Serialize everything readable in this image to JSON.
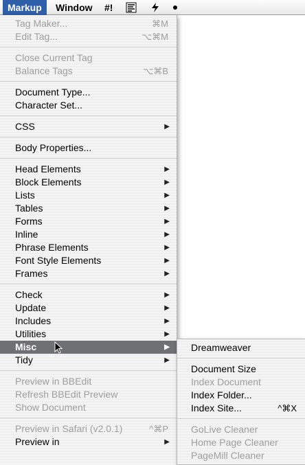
{
  "menubar": {
    "markup": "Markup",
    "window": "Window",
    "hashbang": "#!",
    "icon1": "script-icon",
    "icon2": "lightning-icon"
  },
  "menu": {
    "tag_maker": "Tag Maker...",
    "tag_maker_sc": "⌘M",
    "edit_tag": "Edit Tag...",
    "edit_tag_sc": "⌥⌘M",
    "close_tag": "Close Current Tag",
    "balance_tags": "Balance Tags",
    "balance_tags_sc": "⌥⌘B",
    "doc_type": "Document Type...",
    "char_set": "Character Set...",
    "css": "CSS",
    "body_props": "Body Properties...",
    "head_elements": "Head Elements",
    "block_elements": "Block Elements",
    "lists": "Lists",
    "tables": "Tables",
    "forms": "Forms",
    "inline": "Inline",
    "phrase_elements": "Phrase Elements",
    "font_style_elements": "Font Style Elements",
    "frames": "Frames",
    "check": "Check",
    "update": "Update",
    "includes": "Includes",
    "utilities": "Utilities",
    "misc": "Misc",
    "tidy": "Tidy",
    "preview_bbedit": "Preview in BBEdit",
    "refresh_bbedit": "Refresh BBEdit Preview",
    "show_document": "Show Document",
    "preview_safari": "Preview in Safari (v2.0.1)",
    "preview_safari_sc": "^⌘P",
    "preview_in": "Preview in"
  },
  "submenu": {
    "dreamweaver": "Dreamweaver",
    "document_size": "Document Size",
    "index_document": "Index Document",
    "index_folder": "Index Folder...",
    "index_site": "Index Site...",
    "index_site_sc": "^⌘X",
    "golive_cleaner": "GoLive Cleaner",
    "home_page_cleaner": "Home Page Cleaner",
    "pagemill_cleaner": "PageMill Cleaner"
  },
  "colors": {
    "highlight": "#6f7073",
    "menubar_active": "#2f5fa8",
    "disabled_text": "#9e9e9e"
  }
}
